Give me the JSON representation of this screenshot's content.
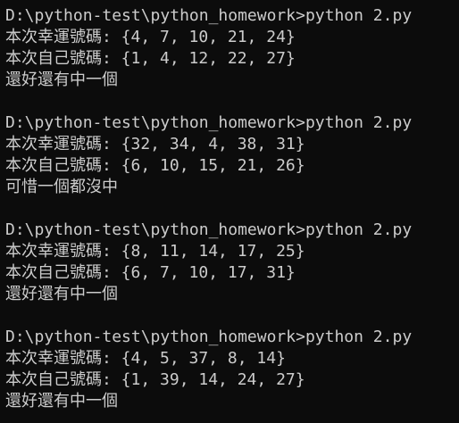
{
  "colors": {
    "background": "#0c0c0c",
    "text": "#cccccc"
  },
  "runs": [
    {
      "prompt": "D:\\python-test\\python_homework>python 2.py",
      "lucky": "本次幸運號碼: {4, 7, 10, 21, 24}",
      "mine": "本次自己號碼: {1, 4, 12, 22, 27}",
      "result": "還好還有中一個"
    },
    {
      "prompt": "D:\\python-test\\python_homework>python 2.py",
      "lucky": "本次幸運號碼: {32, 34, 4, 38, 31}",
      "mine": "本次自己號碼: {6, 10, 15, 21, 26}",
      "result": "可惜一個都沒中"
    },
    {
      "prompt": "D:\\python-test\\python_homework>python 2.py",
      "lucky": "本次幸運號碼: {8, 11, 14, 17, 25}",
      "mine": "本次自己號碼: {6, 7, 10, 17, 31}",
      "result": "還好還有中一個"
    },
    {
      "prompt": "D:\\python-test\\python_homework>python 2.py",
      "lucky": "本次幸運號碼: {4, 5, 37, 8, 14}",
      "mine": "本次自己號碼: {1, 39, 14, 24, 27}",
      "result": "還好還有中一個"
    }
  ]
}
